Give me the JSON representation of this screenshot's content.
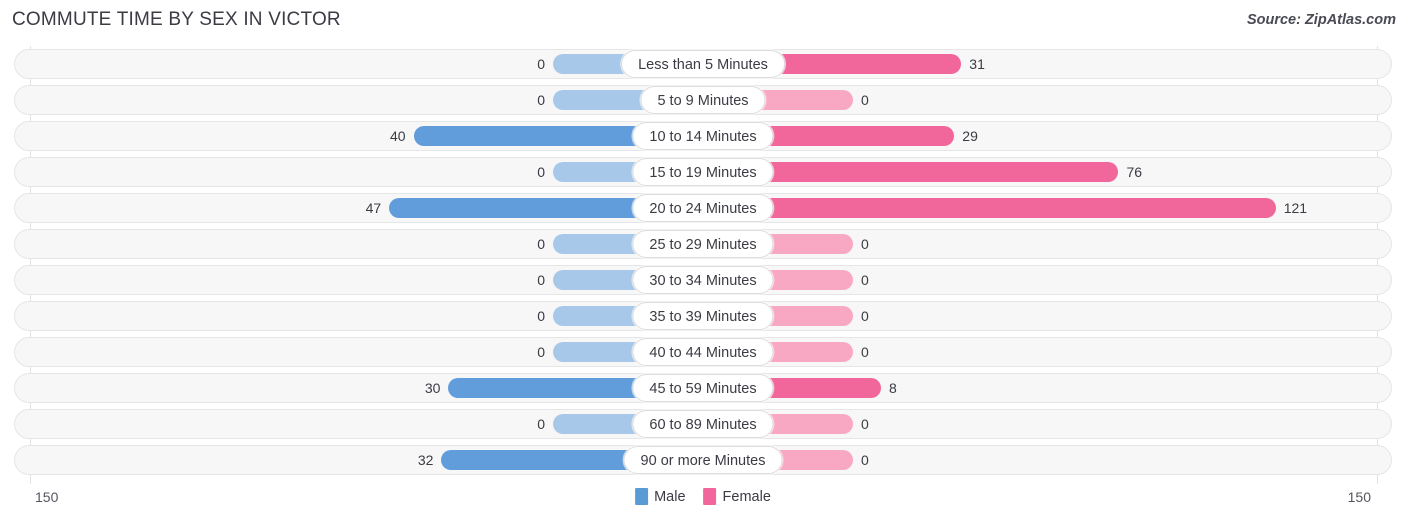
{
  "header": {
    "title": "COMMUTE TIME BY SEX IN VICTOR",
    "source": "Source: ZipAtlas.com"
  },
  "axis": {
    "left_label": "150",
    "right_label": "150",
    "max": 150
  },
  "legend": [
    {
      "label": "Male",
      "color": "#5b9bd5",
      "key": "male"
    },
    {
      "label": "Female",
      "color": "#f2679b",
      "key": "female"
    }
  ],
  "colors": {
    "male_strong": "#629ddb",
    "male_light": "#a8c8ea",
    "female_strong": "#f2679b",
    "female_light": "#f9a8c4",
    "track_bg": "#f7f7f7",
    "track_border": "#e6e6e6",
    "gridline": "#e3e3e6",
    "text": "#3b3b44"
  },
  "chart_data": {
    "type": "bar",
    "orientation": "horizontal",
    "layout": "diverging-bidirectional",
    "title": "COMMUTE TIME BY SEX IN VICTOR",
    "xlabel": "",
    "ylabel": "",
    "xlim": [
      150,
      150
    ],
    "grid": true,
    "legend_position": "bottom-center",
    "categories": [
      "Less than 5 Minutes",
      "5 to 9 Minutes",
      "10 to 14 Minutes",
      "15 to 19 Minutes",
      "20 to 24 Minutes",
      "25 to 29 Minutes",
      "30 to 34 Minutes",
      "35 to 39 Minutes",
      "40 to 44 Minutes",
      "45 to 59 Minutes",
      "60 to 89 Minutes",
      "90 or more Minutes"
    ],
    "series": [
      {
        "name": "Male",
        "color": "#629ddb",
        "direction": "left",
        "values": [
          0,
          0,
          40,
          0,
          47,
          0,
          0,
          0,
          0,
          30,
          0,
          32
        ]
      },
      {
        "name": "Female",
        "color": "#f2679b",
        "direction": "right",
        "values": [
          31,
          0,
          29,
          76,
          121,
          0,
          0,
          0,
          0,
          8,
          0,
          0
        ]
      }
    ]
  },
  "rows": [
    {
      "category": "Less than 5 Minutes",
      "male": "0",
      "female": "31"
    },
    {
      "category": "5 to 9 Minutes",
      "male": "0",
      "female": "0"
    },
    {
      "category": "10 to 14 Minutes",
      "male": "40",
      "female": "29"
    },
    {
      "category": "15 to 19 Minutes",
      "male": "0",
      "female": "76"
    },
    {
      "category": "20 to 24 Minutes",
      "male": "47",
      "female": "121"
    },
    {
      "category": "25 to 29 Minutes",
      "male": "0",
      "female": "0"
    },
    {
      "category": "30 to 34 Minutes",
      "male": "0",
      "female": "0"
    },
    {
      "category": "35 to 39 Minutes",
      "male": "0",
      "female": "0"
    },
    {
      "category": "40 to 44 Minutes",
      "male": "0",
      "female": "0"
    },
    {
      "category": "45 to 59 Minutes",
      "male": "30",
      "female": "8"
    },
    {
      "category": "60 to 89 Minutes",
      "male": "0",
      "female": "0"
    },
    {
      "category": "90 or more Minutes",
      "male": "32",
      "female": "0"
    }
  ]
}
